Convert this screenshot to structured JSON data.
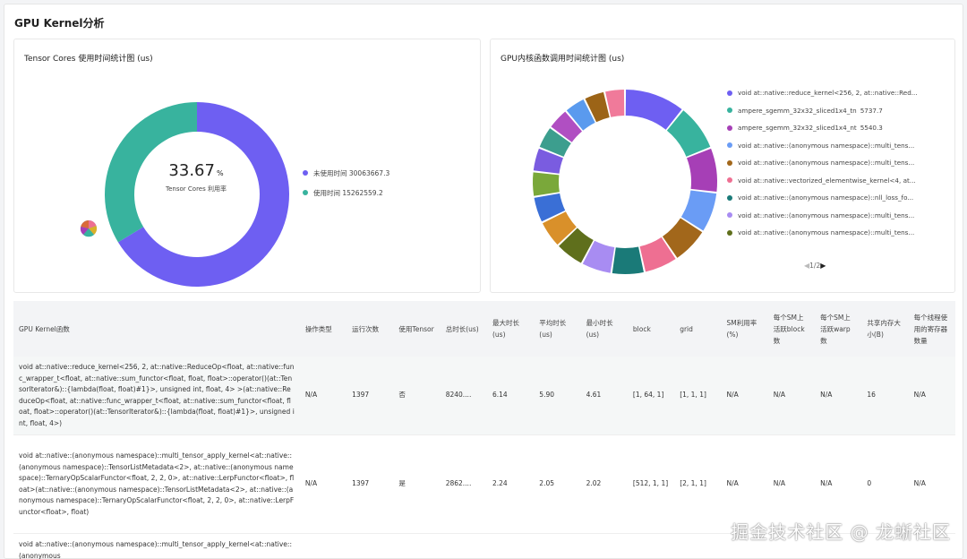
{
  "page": {
    "title": "GPU Kernel分析"
  },
  "tensor_chart": {
    "title": "Tensor Cores 使用时间统计图 (us)",
    "center_value": "33.67",
    "center_unit": "%",
    "center_label": "Tensor Cores 利用率",
    "legend": [
      {
        "name": "未使用时间",
        "value": "30063667.3",
        "color": "#6e5ff2"
      },
      {
        "name": "使用时间",
        "value": "15262559.2",
        "color": "#38b39e"
      }
    ]
  },
  "kernel_chart": {
    "title": "GPU内核函数调用时间统计图 (us)",
    "legend": [
      {
        "name": "void at::native::reduce_kernel<256, 2, at::native::Red...",
        "value": "",
        "color": "#6e5ff2"
      },
      {
        "name": "ampere_sgemm_32x32_sliced1x4_tn",
        "value": "5737.7",
        "color": "#38b39e"
      },
      {
        "name": "ampere_sgemm_32x32_sliced1x4_nt",
        "value": "5540.3",
        "color": "#a63fb6"
      },
      {
        "name": "void at::native::(anonymous namespace)::multi_tens...",
        "value": "",
        "color": "#6a9cf5"
      },
      {
        "name": "void at::native::(anonymous namespace)::multi_tens...",
        "value": "",
        "color": "#a2671b"
      },
      {
        "name": "void at::native::vectorized_elementwise_kernel<4, at...",
        "value": "",
        "color": "#ee6f92"
      },
      {
        "name": "void at::native::(anonymous namespace)::nll_loss_fo...",
        "value": "",
        "color": "#1a7a78"
      },
      {
        "name": "void at::native::(anonymous namespace)::multi_tens...",
        "value": "",
        "color": "#a88cf2"
      },
      {
        "name": "void at::native::(anonymous namespace)::multi_tens...",
        "value": "",
        "color": "#5f6f1c"
      }
    ],
    "pager": {
      "text": "1/2",
      "prev": "◀",
      "next": "▶"
    },
    "ring_colors": [
      "#6e5ff2",
      "#38b39e",
      "#a63fb6",
      "#6a9cf5",
      "#a2671b",
      "#ee6f92",
      "#1a7a78",
      "#a88cf2",
      "#5f6f1c",
      "#d9902a",
      "#3a6fd6",
      "#7aa83a",
      "#7a5ce0",
      "#3c9e8e",
      "#b04fc2",
      "#5a9aee",
      "#9c6417",
      "#f07a9a"
    ],
    "ring_values": [
      10.2,
      7.8,
      7.5,
      6.8,
      6.2,
      5.7,
      5.5,
      5.1,
      4.9,
      4.6,
      4.4,
      4.2,
      4.0,
      3.8,
      3.7,
      3.6,
      3.5,
      3.4
    ]
  },
  "table": {
    "headers": [
      "GPU Kernel函数",
      "操作类型",
      "运行次数",
      "使用Tensor",
      "总时长(us)",
      "最大时长(us)",
      "平均时长(us)",
      "最小时长(us)",
      "block",
      "grid",
      "SM利用率(%)",
      "每个SM上活跃block数",
      "每个SM上活跃warp数",
      "共享内存大小(B)",
      "每个线程使用的寄存器数量"
    ],
    "rows": [
      [
        "void at::native::reduce_kernel<256, 2, at::native::ReduceOp<float, at::native::func_wrapper_t<float, at::native::sum_functor<float, float, float>::operator()(at::TensorIterator&)::{lambda(float, float)#1}>, unsigned int, float, 4> >(at::native::ReduceOp<float, at::native::func_wrapper_t<float, at::native::sum_functor<float, float, float>::operator()(at::TensorIterator&)::{lambda(float, float)#1}>, unsigned int, float, 4>)",
        "N/A",
        "1397",
        "否",
        "8240....",
        "6.14",
        "5.90",
        "4.61",
        "[1, 64, 1]",
        "[1, 1, 1]",
        "N/A",
        "N/A",
        "N/A",
        "16",
        "N/A"
      ],
      [
        "void at::native::(anonymous namespace)::multi_tensor_apply_kernel<at::native::(anonymous namespace)::TensorListMetadata<2>, at::native::(anonymous namespace)::TernaryOpScalarFunctor<float, 2, 2, 0>, at::native::LerpFunctor<float>, float>(at::native::(anonymous namespace)::TensorListMetadata<2>, at::native::(anonymous namespace)::TernaryOpScalarFunctor<float, 2, 2, 0>, at::native::LerpFunctor<float>, float)",
        "N/A",
        "1397",
        "是",
        "2862....",
        "2.24",
        "2.05",
        "2.02",
        "[512, 1, 1]",
        "[2, 1, 1]",
        "N/A",
        "N/A",
        "N/A",
        "0",
        "N/A"
      ],
      [
        "void at::native::(anonymous namespace)::multi_tensor_apply_kernel<at::native::(anonymous",
        "",
        "",
        "",
        "",
        "",
        "",
        "",
        "",
        "",
        "",
        "",
        "",
        "",
        ""
      ]
    ]
  },
  "watermark": "掘金技术社区 @ 龙蜥社区"
}
